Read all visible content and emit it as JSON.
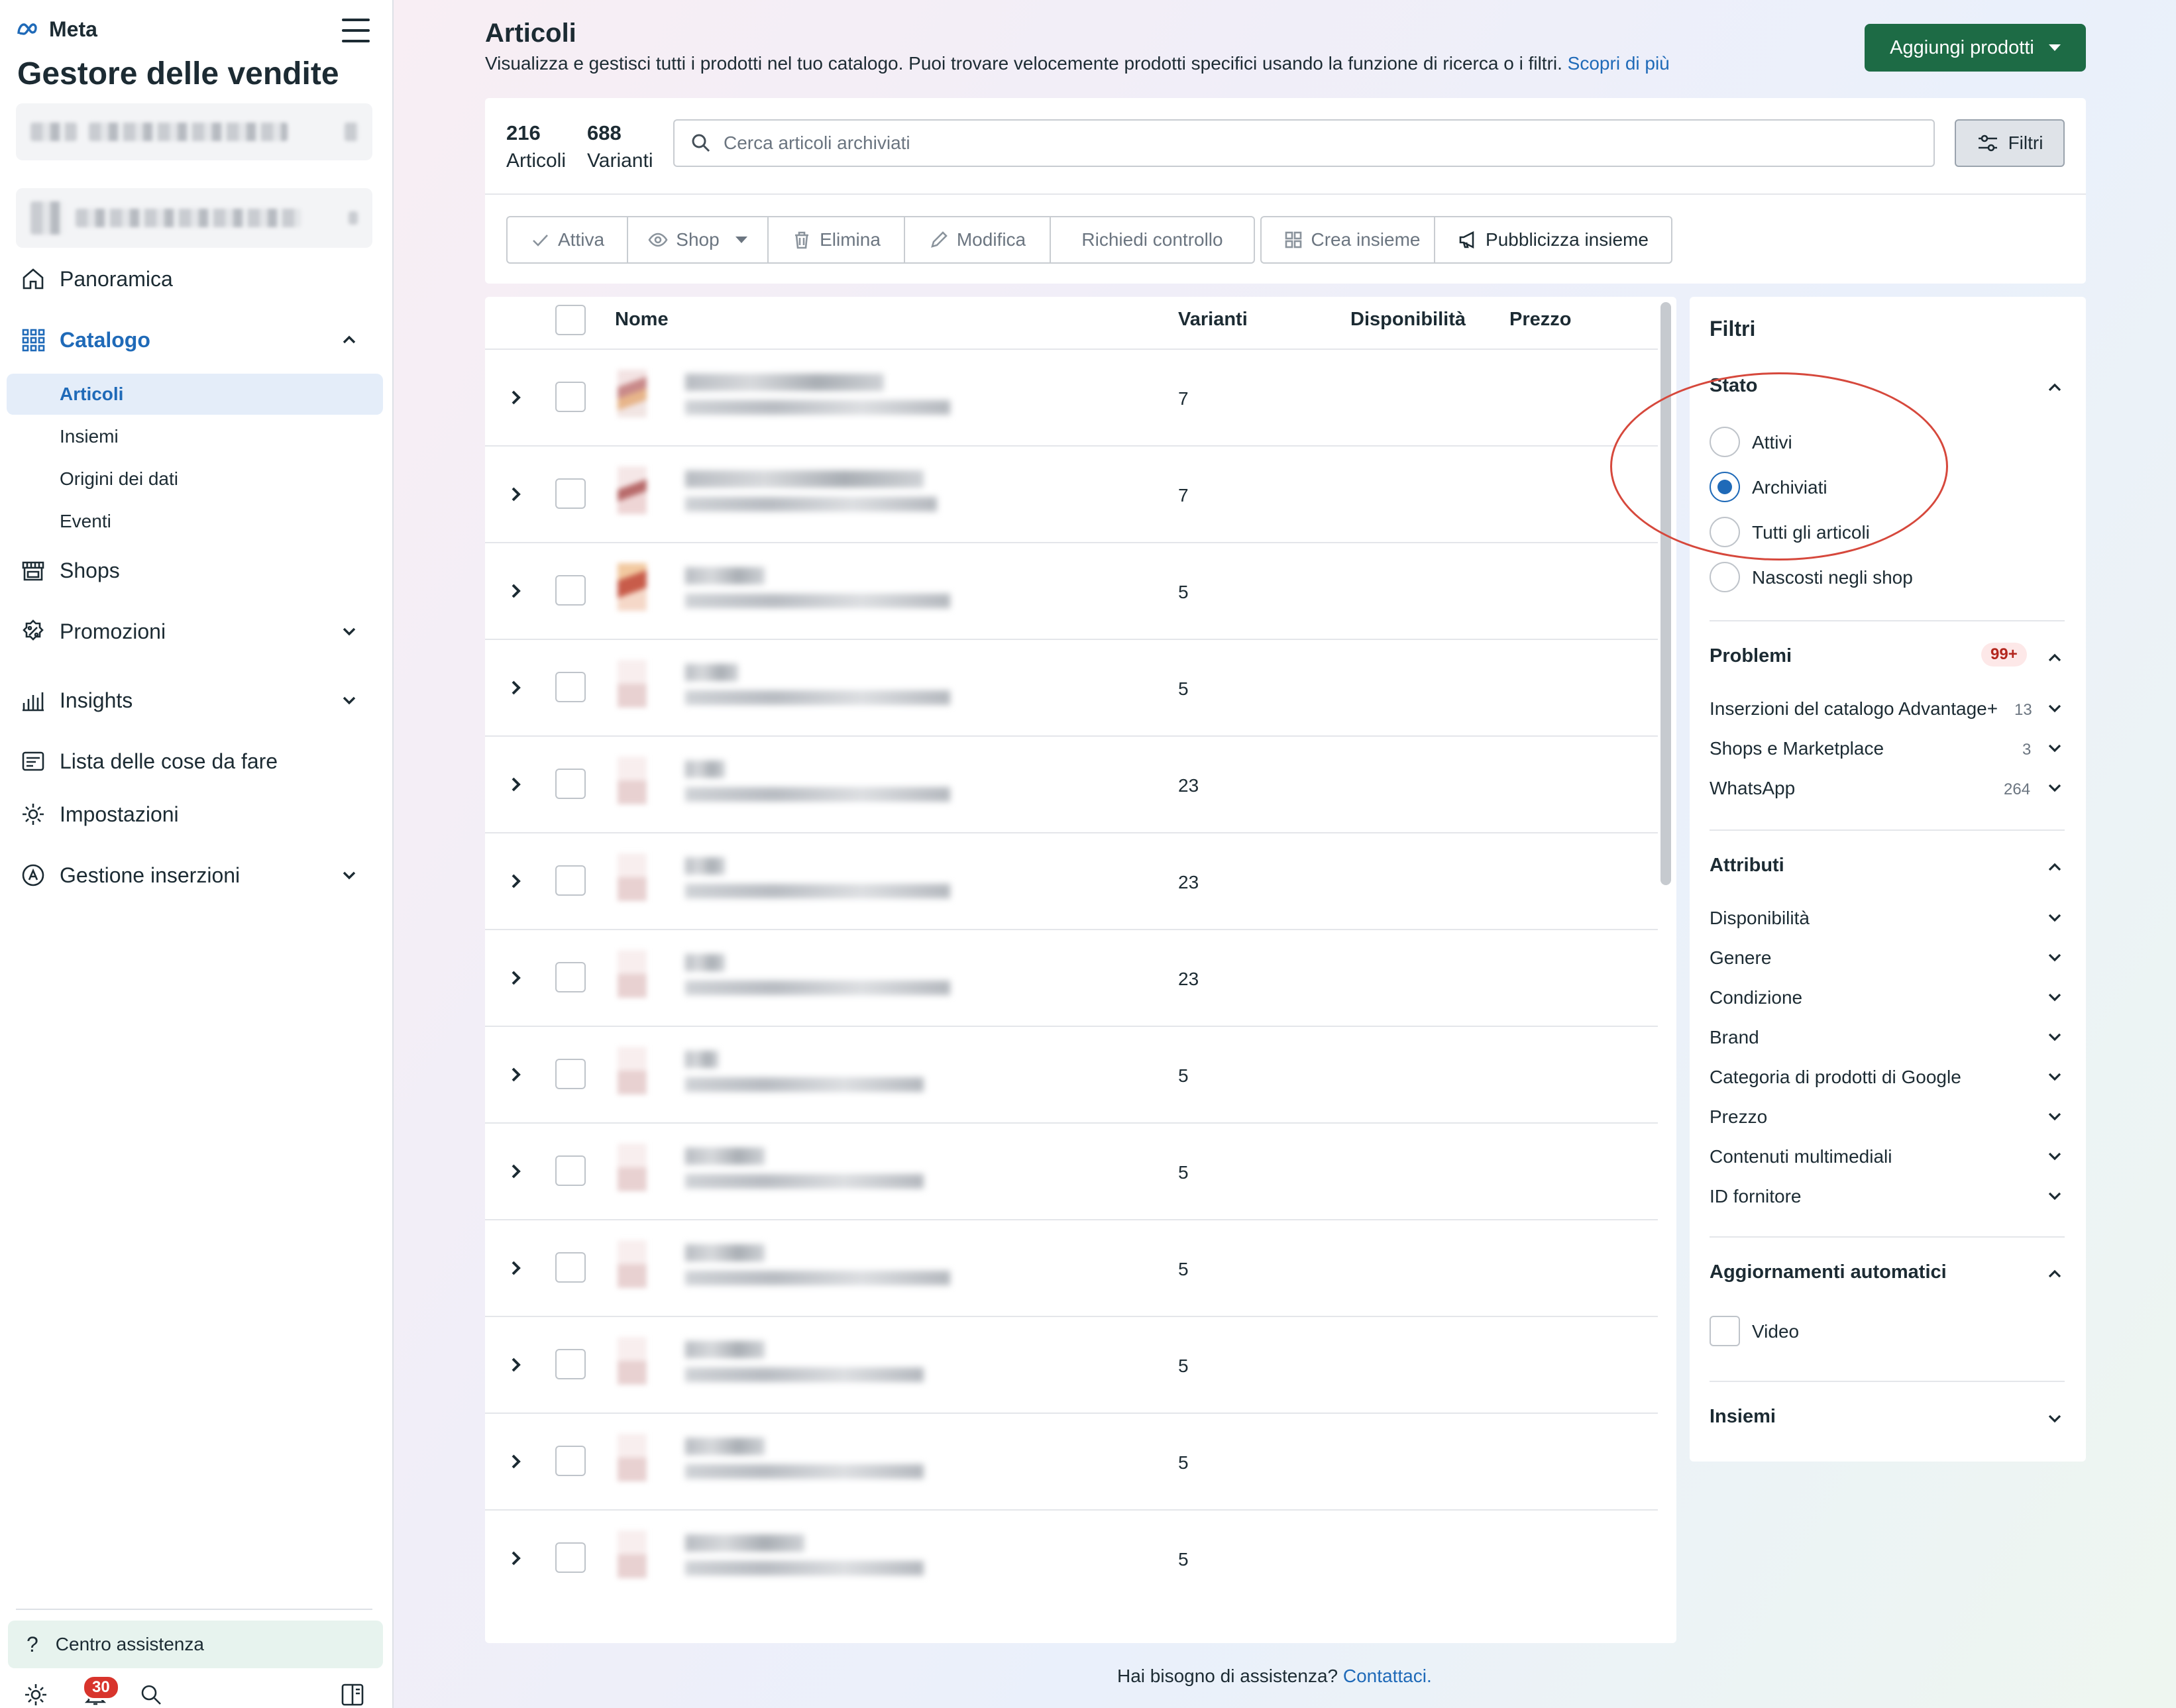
{
  "brand": {
    "logo_text": "Meta",
    "app_title": "Gestore delle vendite"
  },
  "sidebar": {
    "nav": {
      "overview": "Panoramica",
      "catalog": "Catalogo",
      "shops": "Shops",
      "promotions": "Promozioni",
      "insights": "Insights",
      "todo": "Lista delle cose da fare",
      "settings": "Impostazioni",
      "ads": "Gestione inserzioni"
    },
    "catalog_sub": [
      "Articoli",
      "Insiemi",
      "Origini dei dati",
      "Eventi"
    ],
    "help": "Centro assistenza",
    "notifications_count": "30"
  },
  "header": {
    "title": "Articoli",
    "subtitle": "Visualizza e gestisci tutti i prodotti nel tuo catalogo. Puoi trovare velocemente prodotti specifici usando la funzione di ricerca o i filtri.",
    "learn_more": "Scopri di più",
    "add_button": "Aggiungi prodotti"
  },
  "summary": {
    "items_count": "216",
    "items_label": "Articoli",
    "variants_count": "688",
    "variants_label": "Varianti"
  },
  "search": {
    "placeholder": "Cerca articoli archiviati"
  },
  "filters_button": "Filtri",
  "toolbar": {
    "activate": "Attiva",
    "shop": "Shop",
    "delete": "Elimina",
    "edit": "Modifica",
    "request_review": "Richiedi controllo",
    "create_set": "Crea insieme",
    "publish_set": "Pubblicizza insieme"
  },
  "table": {
    "headers": {
      "name": "Nome",
      "variants": "Varianti",
      "availability": "Disponibilità",
      "price": "Prezzo"
    },
    "rows": [
      {
        "variants": "7"
      },
      {
        "variants": "7"
      },
      {
        "variants": "5"
      },
      {
        "variants": "5"
      },
      {
        "variants": "23"
      },
      {
        "variants": "23"
      },
      {
        "variants": "23"
      },
      {
        "variants": "5"
      },
      {
        "variants": "5"
      },
      {
        "variants": "5"
      },
      {
        "variants": "5"
      },
      {
        "variants": "5"
      },
      {
        "variants": "5"
      }
    ]
  },
  "filters": {
    "title": "Filtri",
    "status": {
      "title": "Stato",
      "options": [
        "Attivi",
        "Archiviati",
        "Tutti gli articoli",
        "Nascosti negli shop"
      ],
      "selected": "Archiviati"
    },
    "problems": {
      "title": "Problemi",
      "badge": "99+",
      "items": [
        {
          "label": "Inserzioni del catalogo Advantage+",
          "count": "13"
        },
        {
          "label": "Shops e Marketplace",
          "count": "3"
        },
        {
          "label": "WhatsApp",
          "count": "264"
        }
      ]
    },
    "attributes": {
      "title": "Attributi",
      "items": [
        "Disponibilità",
        "Genere",
        "Condizione",
        "Brand",
        "Categoria di prodotti di Google",
        "Prezzo",
        "Contenuti multimediali",
        "ID fornitore"
      ]
    },
    "auto_updates": {
      "title": "Aggiornamenti automatici",
      "video": "Video"
    },
    "sets": {
      "title": "Insiemi"
    }
  },
  "footer": {
    "text": "Hai bisogno di assistenza?",
    "link": "Contattaci."
  },
  "colors": {
    "accent": "#1f6ab8",
    "primary_button": "#1d6b45",
    "annotation": "#d6483c"
  }
}
